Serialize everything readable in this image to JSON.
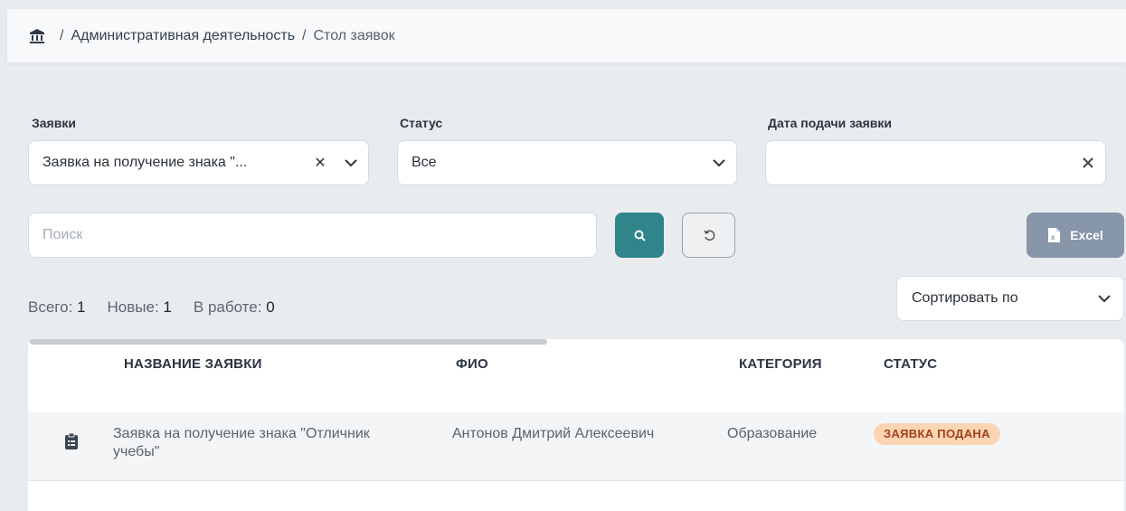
{
  "breadcrumb": {
    "home_icon": "bank-icon",
    "section": "Административная деятельность",
    "current": "Стол заявок"
  },
  "filters": {
    "requests": {
      "label": "Заявки",
      "value": "Заявка на получение знака \"..."
    },
    "status": {
      "label": "Статус",
      "value": "Все"
    },
    "date": {
      "label": "Дата подачи заявки",
      "value": ""
    }
  },
  "search": {
    "placeholder": "Поиск",
    "value": ""
  },
  "buttons": {
    "search_icon": "search-icon",
    "reset_icon": "reset-icon",
    "excel_label": "Excel"
  },
  "counts": {
    "total_label": "Всего:",
    "total": "1",
    "new_label": "Новые:",
    "new": "1",
    "in_work_label": "В работе:",
    "in_work": "0"
  },
  "sort": {
    "placeholder": "Сортировать по"
  },
  "table": {
    "columns": [
      "НАЗВАНИЕ ЗАЯВКИ",
      "ФИО",
      "КАТЕГОРИЯ",
      "СТАТУС"
    ],
    "rows": [
      {
        "icon": "clipboard-icon",
        "name_line1": "Заявка на получение знака \"Отличник",
        "name_line2": "учебы\"",
        "fio": "Антонов Дмитрий Алексеевич",
        "category": "Образование",
        "status": "ЗАЯВКА ПОДАНА"
      }
    ]
  },
  "colors": {
    "accent": "#2f8589",
    "excel_button": "#8795a8",
    "badge_bg": "#fbd4b4",
    "badge_text": "#a0411c"
  }
}
